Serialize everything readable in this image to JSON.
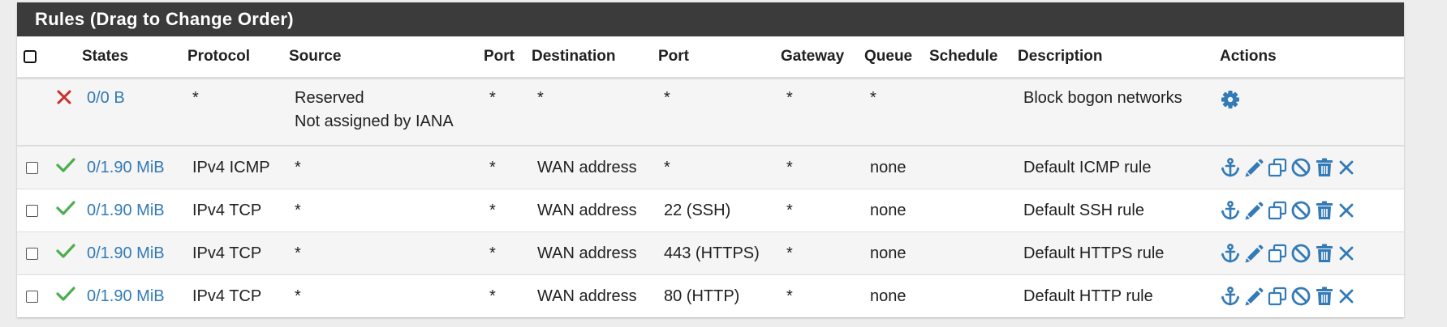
{
  "panel": {
    "title": "Rules (Drag to Change Order)"
  },
  "columns": {
    "states": "States",
    "protocol": "Protocol",
    "source": "Source",
    "source_port": "Port",
    "destination": "Destination",
    "dest_port": "Port",
    "gateway": "Gateway",
    "queue": "Queue",
    "schedule": "Schedule",
    "description": "Description",
    "actions": "Actions"
  },
  "reserved_rule": {
    "status": "block",
    "states": "0/0 B",
    "protocol": "*",
    "source_line1": "Reserved",
    "source_line2": "Not assigned by IANA",
    "source_port": "*",
    "destination": "*",
    "dest_port": "*",
    "gateway": "*",
    "queue": "*",
    "schedule": "",
    "description": "Block bogon networks",
    "action_icon": "gear-icon"
  },
  "rules": [
    {
      "status": "pass",
      "states": "0/1.90 MiB",
      "protocol": "IPv4 ICMP",
      "source": "*",
      "source_port": "*",
      "destination": "WAN address",
      "dest_port": "*",
      "gateway": "*",
      "queue": "none",
      "schedule": "",
      "description": "Default ICMP rule"
    },
    {
      "status": "pass",
      "states": "0/1.90 MiB",
      "protocol": "IPv4 TCP",
      "source": "*",
      "source_port": "*",
      "destination": "WAN address",
      "dest_port": "22 (SSH)",
      "gateway": "*",
      "queue": "none",
      "schedule": "",
      "description": "Default SSH rule"
    },
    {
      "status": "pass",
      "states": "0/1.90 MiB",
      "protocol": "IPv4 TCP",
      "source": "*",
      "source_port": "*",
      "destination": "WAN address",
      "dest_port": "443 (HTTPS)",
      "gateway": "*",
      "queue": "none",
      "schedule": "",
      "description": "Default HTTPS rule"
    },
    {
      "status": "pass",
      "states": "0/1.90 MiB",
      "protocol": "IPv4 TCP",
      "source": "*",
      "source_port": "*",
      "destination": "WAN address",
      "dest_port": "80 (HTTP)",
      "gateway": "*",
      "queue": "none",
      "schedule": "",
      "description": "Default HTTP rule"
    }
  ],
  "row_actions": [
    "anchor-icon",
    "pencil-icon",
    "copy-icon",
    "ban-icon",
    "trash-icon",
    "times-icon"
  ],
  "colors": {
    "header_bg": "#3b3b3b",
    "link": "#337ab7",
    "pass": "#4cae4c",
    "block": "#c9302c",
    "action_icon": "#337ab7"
  }
}
